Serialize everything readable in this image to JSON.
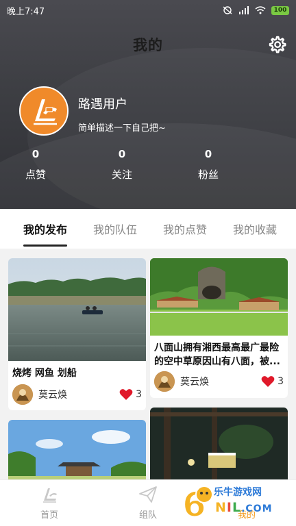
{
  "status": {
    "time": "晚上7:47",
    "battery": "100"
  },
  "header": {
    "title": "我的"
  },
  "profile": {
    "name": "路遇用户",
    "bio": "简单描述一下自己把~"
  },
  "stats": [
    {
      "value": "0",
      "label": "点赞"
    },
    {
      "value": "0",
      "label": "关注"
    },
    {
      "value": "0",
      "label": "粉丝"
    }
  ],
  "tabs": [
    {
      "label": "我的发布",
      "active": true
    },
    {
      "label": "我的队伍",
      "active": false
    },
    {
      "label": "我的点赞",
      "active": false
    },
    {
      "label": "我的收藏",
      "active": false
    }
  ],
  "posts": [
    {
      "title": "烧烤  网鱼 划船",
      "author": "莫云焕",
      "likes": "3"
    },
    {
      "title": "八面山拥有湘西最高最广最险的空中草原因山有八面，被...",
      "author": "莫云焕",
      "likes": "3"
    }
  ],
  "nav": [
    {
      "label": "首页",
      "active": false
    },
    {
      "label": "组队",
      "active": false
    },
    {
      "label": "我的",
      "active": true
    }
  ],
  "watermark": {
    "text": "乐牛游戏网",
    "domain": ".COM"
  },
  "colors": {
    "accent": "#f29b1f",
    "like": "#e0192a",
    "avatar": "#f08a2a"
  }
}
